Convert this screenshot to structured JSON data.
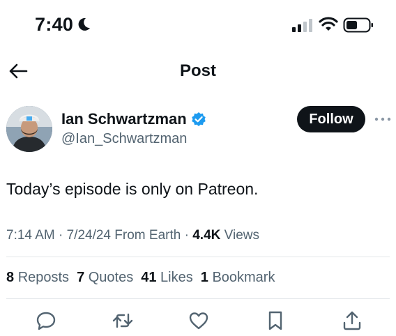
{
  "status_bar": {
    "time": "7:40",
    "icons": [
      "moon-icon",
      "signal-icon",
      "wifi-icon",
      "battery-icon"
    ]
  },
  "nav": {
    "title": "Post",
    "back_icon": "back-arrow-icon"
  },
  "author": {
    "name": "Ian Schwartzman",
    "handle": "@Ian_Schwartzman",
    "verified": true,
    "follow_label": "Follow",
    "more_icon": "more-options-icon"
  },
  "post": {
    "text": "Today’s episode is only on Patreon."
  },
  "meta": {
    "time": "7:14 AM",
    "separator1": " · ",
    "date": "7/24/24",
    "source": " From Earth",
    "separator2": " · ",
    "views_count": "4.4K",
    "views_label": " Views"
  },
  "stats": [
    {
      "count": "8",
      "label": "Reposts"
    },
    {
      "count": "7",
      "label": "Quotes"
    },
    {
      "count": "41",
      "label": "Likes"
    },
    {
      "count": "1",
      "label": "Bookmark"
    }
  ],
  "actions": [
    "reply-icon",
    "repost-icon",
    "like-icon",
    "bookmark-icon",
    "share-icon"
  ],
  "colors": {
    "text": "#0f1419",
    "secondary": "#536471",
    "verified": "#1d9bf0",
    "follow_bg": "#0f1419",
    "divider": "#e3e7ea"
  }
}
